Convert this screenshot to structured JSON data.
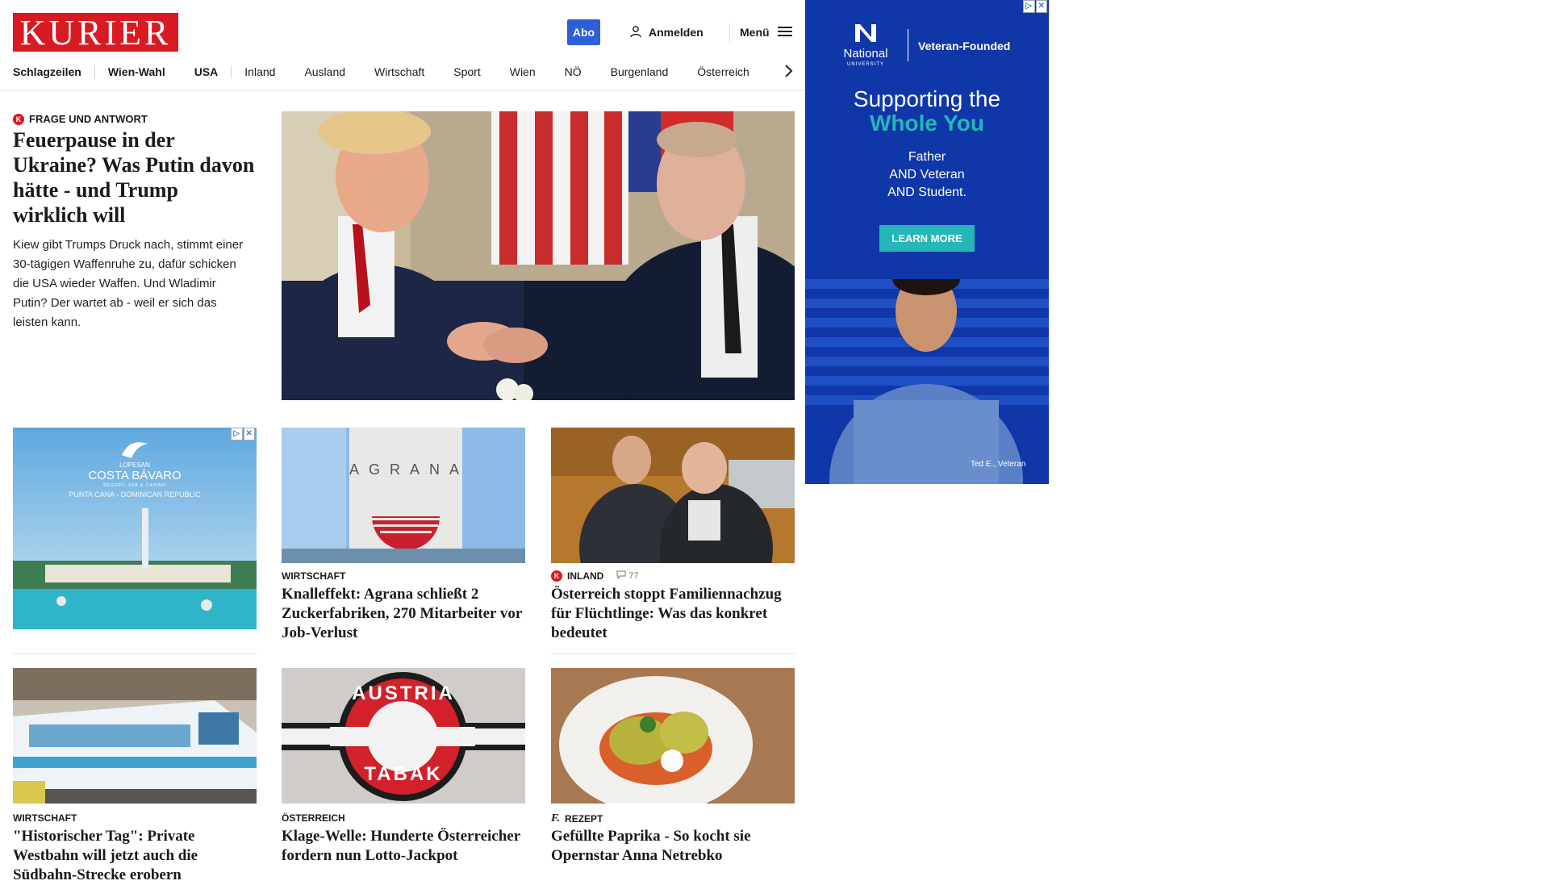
{
  "header": {
    "logo_text": "KURIER",
    "abo_label": "Abo",
    "login_label": "Anmelden",
    "menu_label": "Menü"
  },
  "nav": {
    "items": [
      "Schlagzeilen",
      "Wien-Wahl",
      "USA",
      "Inland",
      "Ausland",
      "Wirtschaft",
      "Sport",
      "Wien",
      "NÖ",
      "Burgenland",
      "Österreich"
    ]
  },
  "lead": {
    "kicker": "FRAGE UND ANTWORT",
    "badge": "K",
    "title": "Feuerpause in der Ukraine? Was Putin davon hätte - und Trump wirklich will",
    "teaser": "Kiew gibt Trumps Druck nach, stimmt einer 30-tägigen Waffenruhe zu, dafür schicken die USA wieder Waffen. Und Wladimir Putin? Der wartet ab - weil er sich das leisten kann."
  },
  "ad_inline": {
    "brand_small": "LOPESAN",
    "brand": "COSTA BÁVARO",
    "brand_sub": "RESORT, SPA & CASINO",
    "location": "PUNTA CANA - DOMINICAN REPUBLIC"
  },
  "cards_row1": [
    {
      "kicker": "WIRTSCHAFT",
      "title": "Knalleffekt: Agrana schließt 2 Zuckerfabriken, 270 Mitarbeiter vor Job-Verlust",
      "sign": "AGRANA"
    },
    {
      "kicker": "INLAND",
      "badge": "K",
      "comments": "77",
      "title": "Österreich stoppt Familiennachzug für Flüchtlinge: Was das konkret bedeutet"
    }
  ],
  "cards_row2": [
    {
      "kicker": "WIRTSCHAFT",
      "title": "\"Historischer Tag\": Private Westbahn will jetzt auch die Südbahn-Strecke erobern"
    },
    {
      "kicker": "ÖSTERREICH",
      "title": "Klage-Welle: Hunderte Österreicher fordern nun Lotto-Jackpot",
      "sign_top": "AUSTRIA",
      "sign_bottom": "TABAK"
    },
    {
      "kicker": "REZEPT",
      "badge": "f.",
      "title": "Gefüllte Paprika - So kocht sie Opernstar Anna Netrebko"
    }
  ],
  "ad_side": {
    "logo_name": "National",
    "logo_sub": "UNIVERSITY",
    "tagline": "Veteran-Founded",
    "headline1": "Supporting the",
    "headline2": "Whole You",
    "body1": "Father",
    "body2": "AND Veteran",
    "body3": "AND Student.",
    "cta": "LEARN MORE",
    "caption": "Ted E., Veteran"
  },
  "colors": {
    "brand_red": "#d81a22",
    "abo_blue": "#2f5ed9",
    "ad_blue": "#1037a8",
    "ad_teal": "#25b6b8"
  }
}
